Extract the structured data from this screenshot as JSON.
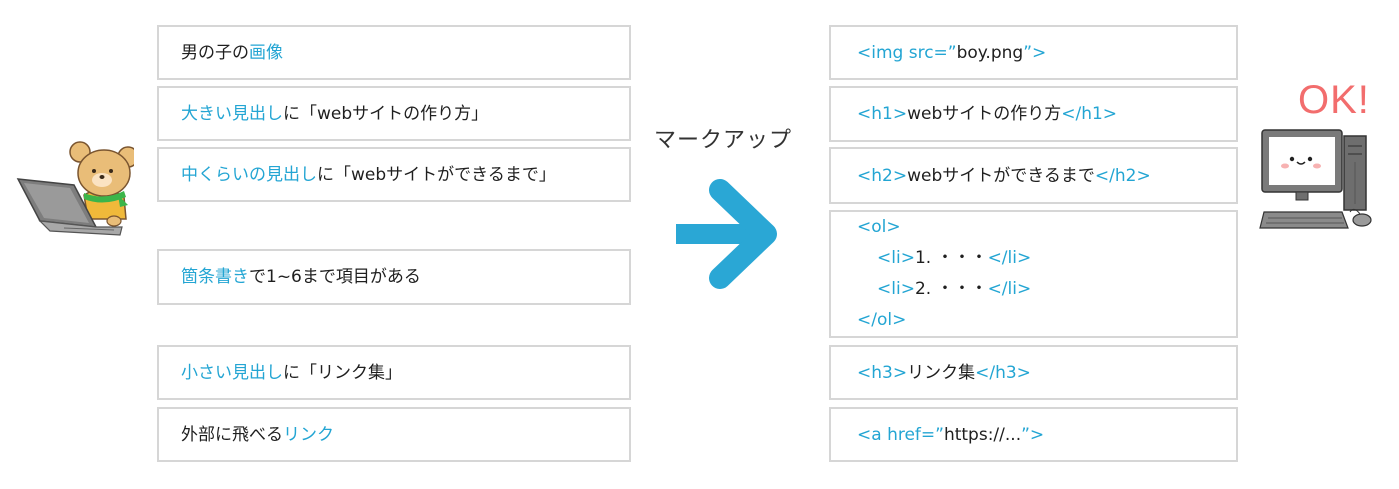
{
  "left_items": [
    {
      "parts": [
        {
          "text": "男の子の",
          "hl": false
        },
        {
          "text": "画像",
          "hl": true
        }
      ]
    },
    {
      "parts": [
        {
          "text": "大きい見出し",
          "hl": true
        },
        {
          "text": "に「webサイトの作り方」",
          "hl": false
        }
      ]
    },
    {
      "parts": [
        {
          "text": "中くらいの見出し",
          "hl": true
        },
        {
          "text": "に「webサイトができるまで」",
          "hl": false
        }
      ]
    },
    {
      "parts": [
        {
          "text": "箇条書き",
          "hl": true
        },
        {
          "text": "で1~6まで項目がある",
          "hl": false
        }
      ]
    },
    {
      "parts": [
        {
          "text": "小さい見出し",
          "hl": true
        },
        {
          "text": "に「リンク集」",
          "hl": false
        }
      ]
    },
    {
      "parts": [
        {
          "text": "外部に飛べる",
          "hl": false
        },
        {
          "text": "リンク",
          "hl": true
        }
      ]
    }
  ],
  "right_items": [
    {
      "lines": [
        [
          {
            "text": "<img src=”",
            "hl": true
          },
          {
            "text": "boy.png",
            "hl": false
          },
          {
            "text": "”>",
            "hl": true
          }
        ]
      ]
    },
    {
      "lines": [
        [
          {
            "text": "<h1>",
            "hl": true
          },
          {
            "text": "webサイトの作り方",
            "hl": false
          },
          {
            "text": "</h1>",
            "hl": true
          }
        ]
      ]
    },
    {
      "lines": [
        [
          {
            "text": "<h2>",
            "hl": true
          },
          {
            "text": "webサイトができるまで",
            "hl": false
          },
          {
            "text": "</h2>",
            "hl": true
          }
        ]
      ]
    },
    {
      "lines": [
        [
          {
            "text": "<ol>",
            "hl": true
          }
        ],
        [
          {
            "text": "<li>",
            "hl": true
          },
          {
            "text": "1. ・・・",
            "hl": false
          },
          {
            "text": "</li>",
            "hl": true
          }
        ],
        [
          {
            "text": "<li>",
            "hl": true
          },
          {
            "text": "2. ・・・",
            "hl": false
          },
          {
            "text": "</li>",
            "hl": true
          }
        ],
        [
          {
            "text": "</ol>",
            "hl": true
          }
        ]
      ]
    },
    {
      "lines": [
        [
          {
            "text": "<h3>",
            "hl": true
          },
          {
            "text": "リンク集",
            "hl": false
          },
          {
            "text": "</h3>",
            "hl": true
          }
        ]
      ]
    },
    {
      "lines": [
        [
          {
            "text": "<a href=”",
            "hl": true
          },
          {
            "text": "https://...",
            "hl": false
          },
          {
            "text": "”>",
            "hl": true
          }
        ]
      ]
    }
  ],
  "arrow_label": "マークアップ",
  "ok_label": "OK!",
  "illustrations": {
    "left": "bear-with-laptop-icon",
    "right": "smiling-computer-icon"
  },
  "colors": {
    "highlight": "#23a5d3",
    "arrow": "#2aa7d5",
    "ok": "#f26d6d",
    "border": "#d6d6d6"
  }
}
